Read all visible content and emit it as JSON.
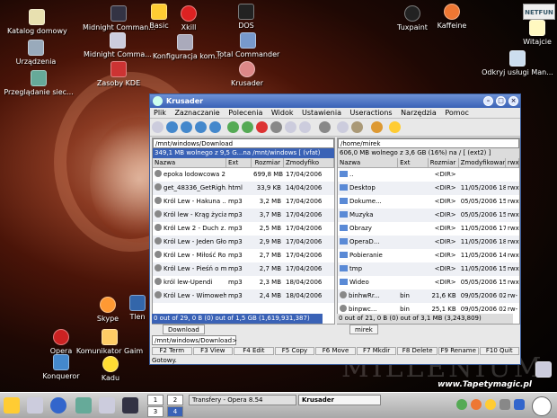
{
  "desktop": {
    "icons": [
      {
        "label": "Katalog domowy"
      },
      {
        "label": "Urządzenia"
      },
      {
        "label": "Przeglądanie siec..."
      },
      {
        "label": "Midnight Comman..."
      },
      {
        "label": "Midnight Comma..."
      },
      {
        "label": "Zasoby KDE"
      },
      {
        "label": "Basic"
      },
      {
        "label": "Xkill"
      },
      {
        "label": "Konfiguracja kom..."
      },
      {
        "label": "DOS"
      },
      {
        "label": "Total Commander"
      },
      {
        "label": "Krusader"
      },
      {
        "label": "Tuxpaint"
      },
      {
        "label": "Kaffeine"
      },
      {
        "label": "Witajcie"
      },
      {
        "label": "Odkryj usługi Man..."
      },
      {
        "label": "Skype"
      },
      {
        "label": "Tlen"
      },
      {
        "label": "Opera"
      },
      {
        "label": "Komunikator Gaim"
      },
      {
        "label": "Konqueror"
      },
      {
        "label": "Kadu"
      }
    ],
    "watermark_top": "NETFUN",
    "wallpaper_text": "MILLENIUM",
    "watermark_url": "www.Tapetymagic.pl"
  },
  "window": {
    "title": "Krusader",
    "menu": [
      "Plik",
      "Zaznaczanie",
      "Polecenia",
      "Widok",
      "Ustawienia",
      "Useractions",
      "Narzędzia",
      "Pomoc"
    ],
    "left": {
      "path": "/mnt/windows/Download",
      "free": "349,1 MB wolnego z 9,5 G...na /mnt/windows [ (vfat)",
      "headers": {
        "name": "Nazwa",
        "ext": "Ext",
        "size": "Rozmiar",
        "date": "Zmodyfiko"
      },
      "rows": [
        {
          "name": "epoka lodowcowa 2 ...",
          "ext": "",
          "size": "699,8 MB",
          "date": "17/04/2006"
        },
        {
          "name": "get_48336_GetRigh...",
          "ext": "html",
          "size": "33,9 KB",
          "date": "14/04/2006"
        },
        {
          "name": "Król Lew - Hakuna ...",
          "ext": "mp3",
          "size": "3,2 MB",
          "date": "17/04/2006"
        },
        {
          "name": "Król lew - Krąg życia",
          "ext": "mp3",
          "size": "3,7 MB",
          "date": "17/04/2006"
        },
        {
          "name": "Król Lew 2 - Duch z...",
          "ext": "mp3",
          "size": "2,5 MB",
          "date": "17/04/2006"
        },
        {
          "name": "Król Lew - Jeden Głos",
          "ext": "mp3",
          "size": "2,9 MB",
          "date": "17/04/2006"
        },
        {
          "name": "Król Lew - Miłość Ro...",
          "ext": "mp3",
          "size": "2,7 MB",
          "date": "17/04/2006"
        },
        {
          "name": "Król Lew - Pieśń o m...",
          "ext": "mp3",
          "size": "2,7 MB",
          "date": "17/04/2006"
        },
        {
          "name": "król lew-Upendi",
          "ext": "mp3",
          "size": "2,3 MB",
          "date": "18/04/2006"
        },
        {
          "name": "Król Lew - Wimoweh",
          "ext": "mp3",
          "size": "2,4 MB",
          "date": "18/04/2006"
        }
      ],
      "status": "0 out of 29, 0 B (0) out of 1,5 GB (1,619,931,387)",
      "tab": "Download"
    },
    "right": {
      "path": "/home/mirek",
      "free": "606,0 MB wolnego z 3,6 GB (16%) na / [ (ext2) ]",
      "headers": {
        "name": "Nazwa",
        "ext": "Ext",
        "size": "Rozmiar",
        "date": "Zmodyfikowany",
        "perm": "rwx"
      },
      "rows": [
        {
          "name": "..",
          "ext": "",
          "size": "<DIR>",
          "date": "",
          "perm": ""
        },
        {
          "name": "Desktop",
          "ext": "",
          "size": "<DIR>",
          "date": "11/05/2006 18:18",
          "perm": "rwx"
        },
        {
          "name": "Dokume...",
          "ext": "",
          "size": "<DIR>",
          "date": "05/05/2006 15:48",
          "perm": "rwx"
        },
        {
          "name": "Muzyka",
          "ext": "",
          "size": "<DIR>",
          "date": "05/05/2006 15:48",
          "perm": "rwx"
        },
        {
          "name": "Obrazy",
          "ext": "",
          "size": "<DIR>",
          "date": "11/05/2006 17:49",
          "perm": "rwx"
        },
        {
          "name": "OperaD...",
          "ext": "",
          "size": "<DIR>",
          "date": "11/05/2006 18:07",
          "perm": "rwx"
        },
        {
          "name": "Pobieranie",
          "ext": "",
          "size": "<DIR>",
          "date": "11/05/2006 14:51",
          "perm": "rwx"
        },
        {
          "name": "tmp",
          "ext": "",
          "size": "<DIR>",
          "date": "11/05/2006 15:15",
          "perm": "rwx"
        },
        {
          "name": "Wideo",
          "ext": "",
          "size": "<DIR>",
          "date": "05/05/2006 15:48",
          "perm": "rwx"
        },
        {
          "name": "binhwRr...",
          "ext": "bin",
          "size": "21,6 KB",
          "date": "09/05/2006 02:15",
          "perm": "rw-"
        },
        {
          "name": "binpwc...",
          "ext": "bin",
          "size": "25,1 KB",
          "date": "09/05/2006 02:15",
          "perm": "rw-"
        }
      ],
      "status": "0 out of 21, 0 B (0) out of 3,1 MB (3,243,809)",
      "tab": "mirek"
    },
    "cmdline": "/mnt/windows/Download>",
    "fkeys": [
      "F2 Term",
      "F3 View",
      "F4 Edit",
      "F5 Copy",
      "F6 Move",
      "F7 Mkdir",
      "F8 Delete",
      "F9 Rename",
      "F10 Quit"
    ],
    "status": "Gotowy."
  },
  "taskbar": {
    "pages": [
      "1",
      "2",
      "3",
      "4"
    ],
    "tasks": [
      "Transfery - Opera 8.54",
      "Krusader"
    ]
  }
}
